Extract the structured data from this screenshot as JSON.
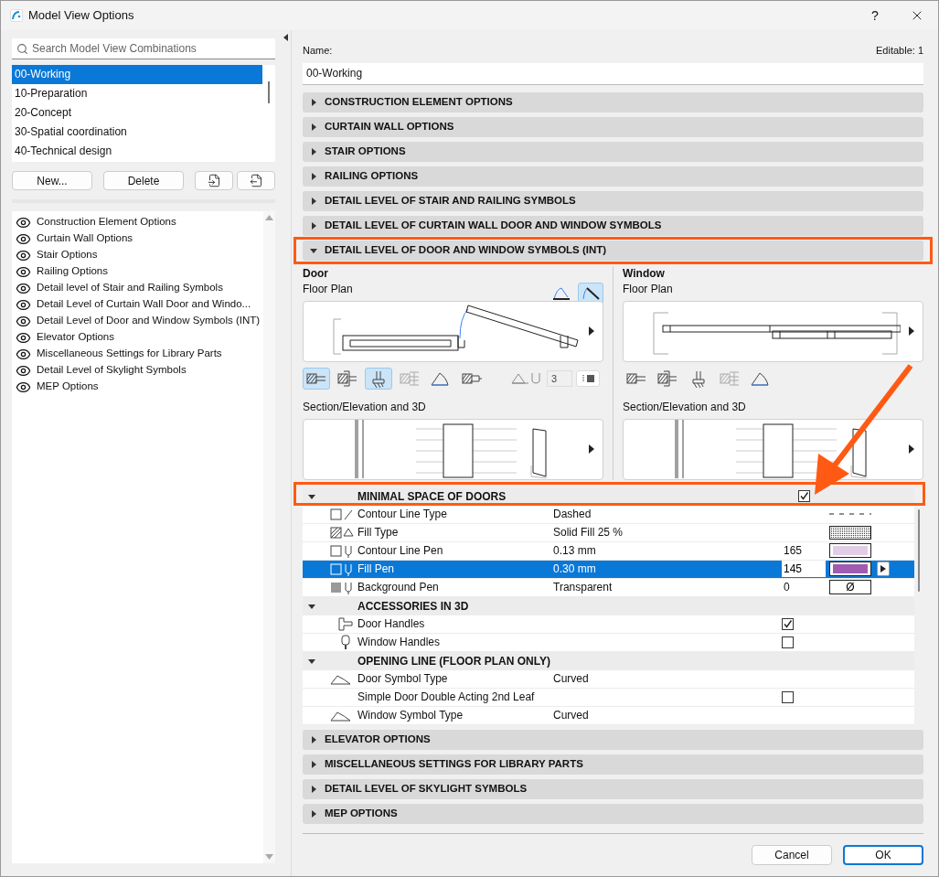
{
  "window": {
    "title": "Model View Options",
    "help": "?"
  },
  "combinations": {
    "search_placeholder": "Search Model View Combinations",
    "items": [
      {
        "label": "00-Working",
        "selected": true
      },
      {
        "label": "10-Preparation",
        "selected": false
      },
      {
        "label": "20-Concept",
        "selected": false
      },
      {
        "label": "30-Spatial coordination",
        "selected": false
      },
      {
        "label": "40-Technical design",
        "selected": false
      }
    ],
    "buttons": [
      "New...",
      "Delete"
    ]
  },
  "option_sets": [
    "Construction Element Options",
    "Curtain Wall Options",
    "Stair Options",
    "Railing Options",
    "Detail level of Stair and Railing Symbols",
    "Detail Level of Curtain Wall Door and Windo...",
    "Detail Level of Door and Window Symbols (INT)",
    "Elevator Options",
    "Miscellaneous Settings for Library Parts",
    "Detail Level of Skylight Symbols",
    "MEP Options"
  ],
  "name_label": "Name:",
  "name_value": "00-Working",
  "editable": "Editable: 1",
  "sections": [
    {
      "title": "CONSTRUCTION ELEMENT OPTIONS",
      "expanded": false
    },
    {
      "title": "CURTAIN WALL OPTIONS",
      "expanded": false
    },
    {
      "title": "STAIR OPTIONS",
      "expanded": false
    },
    {
      "title": "RAILING OPTIONS",
      "expanded": false
    },
    {
      "title": "DETAIL LEVEL OF STAIR AND RAILING SYMBOLS",
      "expanded": false
    },
    {
      "title": "DETAIL LEVEL OF CURTAIN WALL DOOR AND WINDOW SYMBOLS",
      "expanded": false
    },
    {
      "title": "DETAIL LEVEL OF DOOR AND WINDOW SYMBOLS (INT)",
      "expanded": true
    },
    {
      "title": "ELEVATOR OPTIONS",
      "expanded": false
    },
    {
      "title": "MISCELLANEOUS SETTINGS FOR LIBRARY PARTS",
      "expanded": false
    },
    {
      "title": "DETAIL LEVEL OF SKYLIGHT SYMBOLS",
      "expanded": false
    },
    {
      "title": "MEP OPTIONS",
      "expanded": false
    }
  ],
  "expanded_content": {
    "door": {
      "heading": "Door",
      "plan_label": "Floor Plan",
      "section_label": "Section/Elevation and 3D",
      "symbol_toggles": [
        {
          "selected": false
        },
        {
          "selected": true
        }
      ],
      "tools": [
        {
          "selected": true
        },
        {
          "selected": false
        },
        {
          "selected": true
        },
        {
          "selected": false
        },
        {
          "selected": false
        },
        {
          "selected": false
        }
      ],
      "count_field": {
        "value": "3",
        "disabled": true
      }
    },
    "window": {
      "heading": "Window",
      "plan_label": "Floor Plan",
      "section_label": "Section/Elevation and 3D",
      "tools": [
        {
          "selected": false
        },
        {
          "selected": false
        },
        {
          "selected": false
        },
        {
          "selected": false
        },
        {
          "selected": false
        }
      ]
    },
    "groups": [
      {
        "title": "MINIMAL SPACE OF DOORS",
        "expanded": true,
        "checked": true,
        "rows": [
          {
            "kind": "line_type",
            "label": "Contour Line Type",
            "value": "Dashed",
            "selected": false
          },
          {
            "kind": "fill_type",
            "label": "Fill Type",
            "value": "Solid Fill 25 %",
            "selected": false
          },
          {
            "kind": "pen",
            "label": "Contour Line Pen",
            "value": "0.13 mm",
            "number": "165",
            "color": "#e2cde6",
            "selected": false
          },
          {
            "kind": "pen",
            "label": "Fill Pen",
            "value": "0.30 mm",
            "number": "145",
            "color": "#a05cb0",
            "selected": true
          },
          {
            "kind": "empty_pen",
            "label": "Background Pen",
            "value": "Transparent",
            "number": "0",
            "swatch_text": "Ø",
            "selected": false
          }
        ]
      },
      {
        "title": "ACCESSORIES IN 3D",
        "expanded": true,
        "rows": [
          {
            "kind": "check",
            "label": "Door Handles",
            "checked": true,
            "selected": false
          },
          {
            "kind": "check",
            "label": "Window Handles",
            "checked": false,
            "selected": false
          }
        ]
      },
      {
        "title": "OPENING LINE (FLOOR PLAN ONLY)",
        "expanded": true,
        "rows": [
          {
            "kind": "symbol",
            "label": "Door Symbol Type",
            "value": "Curved",
            "selected": false
          },
          {
            "kind": "check",
            "label": "Simple Door Double Acting 2nd Leaf",
            "checked": false,
            "selected": false
          },
          {
            "kind": "symbol",
            "label": "Window Symbol Type",
            "value": "Curved",
            "selected": false
          }
        ]
      }
    ]
  },
  "footer_buttons": [
    {
      "label": "Cancel",
      "primary": false
    },
    {
      "label": "OK",
      "primary": true
    }
  ]
}
